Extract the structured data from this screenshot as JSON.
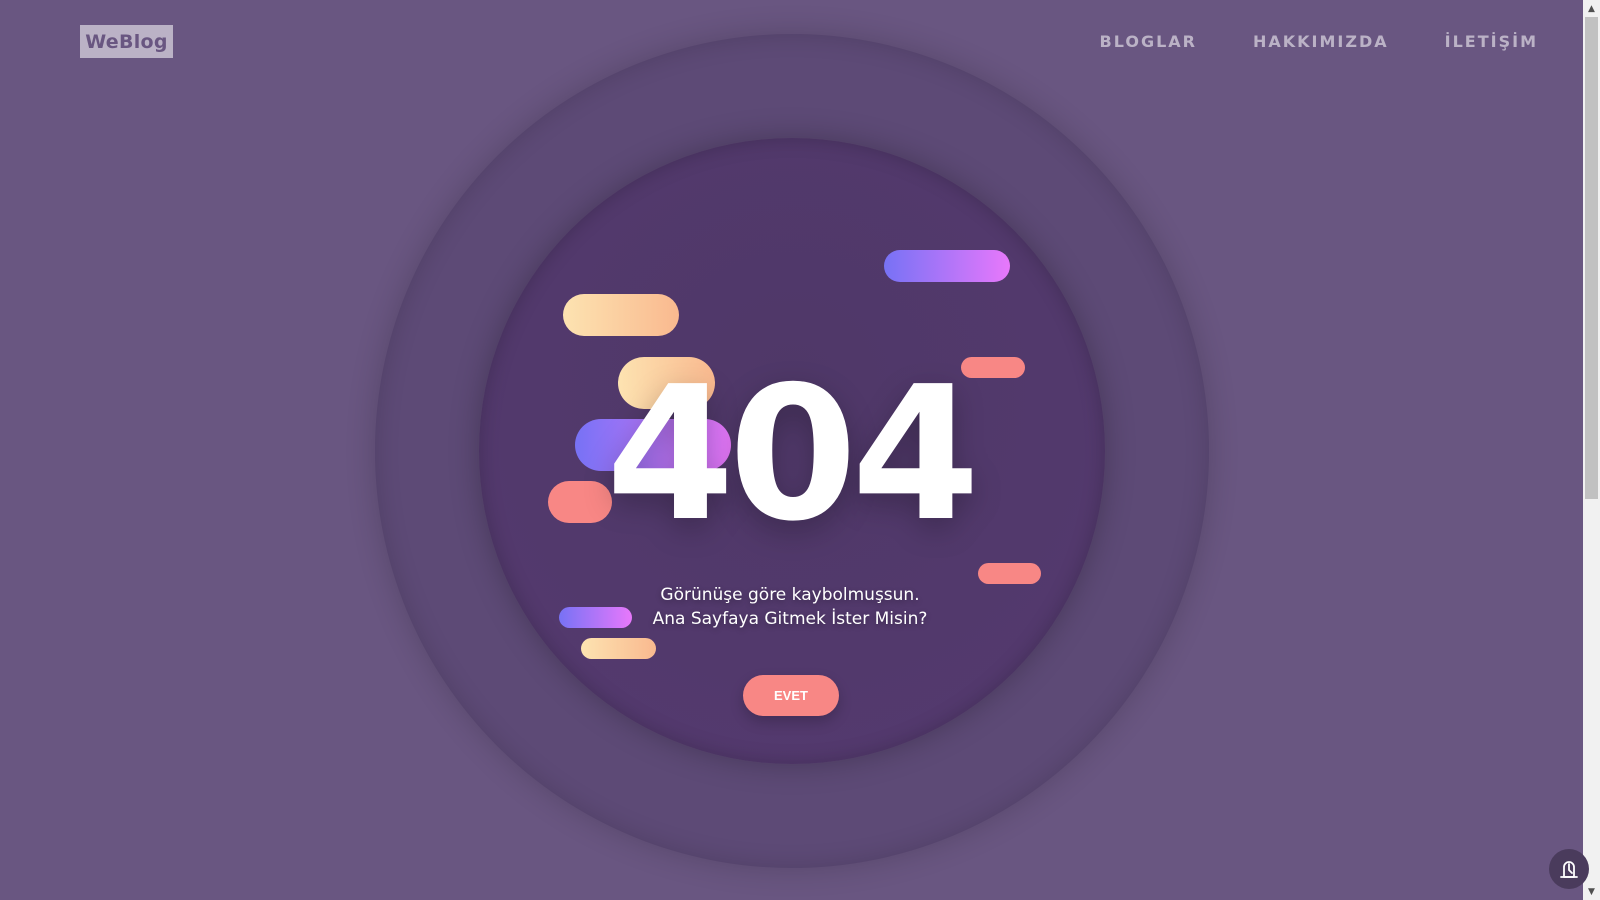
{
  "header": {
    "logo": "WeBlog",
    "nav": [
      "BLOGLAR",
      "HAKKIMIZDA",
      "İLETİŞİM"
    ]
  },
  "error": {
    "code": "404",
    "line1": "Görünüşe göre kaybolmuşsun.",
    "line2": "Ana Sayfaya Gitmek İster Misin?",
    "button_label": "EVET"
  },
  "colors": {
    "background": "#695681",
    "accent_coral": "#f88785",
    "peach_gradient": [
      "#fde3b1",
      "#f9b98f"
    ],
    "purple_gradient": [
      "#7772f5",
      "#e878fb"
    ]
  },
  "icons": {
    "floating_button": "accessibility-icon"
  }
}
